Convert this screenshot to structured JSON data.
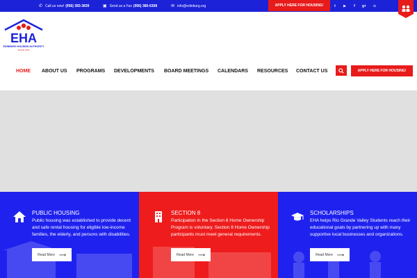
{
  "topbar": {
    "call_label": "Call us now!",
    "call_number": "(956) 383-3839",
    "fax_label": "Send us a Fax",
    "fax_number": "(956) 380-6308",
    "email": "info@edinburg.org",
    "apply_button": "APPLY HERE FOR HOUSING!",
    "social": [
      {
        "name": "twitter-icon",
        "glyph": "t"
      },
      {
        "name": "youtube-icon",
        "glyph": "▶"
      },
      {
        "name": "facebook-icon",
        "glyph": "f"
      },
      {
        "name": "google-plus-icon",
        "glyph": "g+"
      },
      {
        "name": "instagram-icon",
        "glyph": "◘"
      }
    ]
  },
  "logo": {
    "letters": "EHA",
    "subtitle": "EDINBURG HOUSING AUTHORITY",
    "since": "SINCE 1940"
  },
  "nav": {
    "items": [
      "HOME",
      "ABOUT US",
      "PROGRAMS",
      "DEVELOPMENTS",
      "BOARD MEETINGS",
      "CALENDARS",
      "RESOURCES",
      "CONTACT US"
    ],
    "apply_button": "APPLY HERE FOR HOUSING!"
  },
  "panels": [
    {
      "title": "PUBLIC HOUSING",
      "text": "Public housing was established to provide decent and safe rental housing for eligible low-income families, the elderly, and persons with disabilities.",
      "button": "Read More",
      "icon": "house-icon"
    },
    {
      "title": "SECTION 8",
      "text": "Participation in the Section 8 Home Ownership Program is voluntary. Section 8 Home Ownership participants must meet general requirements.",
      "button": "Read More",
      "icon": "building-icon"
    },
    {
      "title": "SCHOLARSHIPS",
      "text": "EHA helps Rio Grande Valley Students reach their educational goals by partnering up with many supportive local businesses and organizations.",
      "button": "Read More",
      "icon": "graduation-cap-icon"
    }
  ],
  "colors": {
    "brand_blue": "#1c22d8",
    "brand_red": "#e81b1b",
    "panel_blue": "#1f22ee",
    "panel_red": "#ee1c1c",
    "hero_gray": "#e0e0e0"
  }
}
